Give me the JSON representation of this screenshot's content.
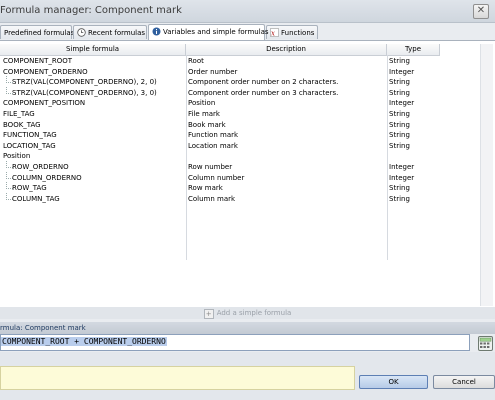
{
  "window": {
    "title": "Formula manager: Component mark",
    "close_glyph": "✕"
  },
  "tabs": [
    {
      "label": "Predefined formulas",
      "icon": "formula-list-icon",
      "active": false
    },
    {
      "label": "Recent formulas",
      "icon": "clock-icon",
      "active": false
    },
    {
      "label": "Variables and simple formulas",
      "icon": "info-icon",
      "active": true
    },
    {
      "label": "Functions",
      "icon": "function-fx-icon",
      "active": false
    }
  ],
  "table": {
    "columns": [
      "Simple formula",
      "Description",
      "Type"
    ],
    "rows": [
      {
        "formula": "COMPONENT_ROOT",
        "description": "Root",
        "type": "String",
        "indent": 0
      },
      {
        "formula": "COMPONENT_ORDERNO",
        "description": "Order number",
        "type": "Integer",
        "indent": 0
      },
      {
        "formula": "STRZ(VAL(COMPONENT_ORDERNO), 2, 0)",
        "description": "Component order number on 2 characters.",
        "type": "String",
        "indent": 1
      },
      {
        "formula": "STRZ(VAL(COMPONENT_ORDERNO), 3, 0)",
        "description": "Component order number on 3 characters.",
        "type": "String",
        "indent": 1
      },
      {
        "formula": "COMPONENT_POSITION",
        "description": "Position",
        "type": "Integer",
        "indent": 0
      },
      {
        "formula": "FILE_TAG",
        "description": "File mark",
        "type": "String",
        "indent": 0
      },
      {
        "formula": "BOOK_TAG",
        "description": "Book mark",
        "type": "String",
        "indent": 0
      },
      {
        "formula": "FUNCTION_TAG",
        "description": "Function mark",
        "type": "String",
        "indent": 0
      },
      {
        "formula": "LOCATION_TAG",
        "description": "Location mark",
        "type": "String",
        "indent": 0
      },
      {
        "formula": "Position",
        "description": "",
        "type": "",
        "indent": 0
      },
      {
        "formula": "ROW_ORDERNO",
        "description": "Row number",
        "type": "Integer",
        "indent": 1
      },
      {
        "formula": "COLUMN_ORDERNO",
        "description": "Column number",
        "type": "Integer",
        "indent": 1
      },
      {
        "formula": "ROW_TAG",
        "description": "Row mark",
        "type": "String",
        "indent": 1
      },
      {
        "formula": "COLUMN_TAG",
        "description": "Column mark",
        "type": "String",
        "indent": 1
      }
    ]
  },
  "add_button": {
    "label": "Add a simple formula"
  },
  "formula_panel": {
    "label": "rmula: Component mark",
    "value": "COMPONENT_ROOT + COMPONENT_ORDERNO"
  },
  "buttons": {
    "ok": "OK",
    "cancel": "Cancel"
  },
  "colors": {
    "accent": "#2f5f9e",
    "selection": "#b9cdec",
    "note_bg": "#fdfbd8"
  }
}
